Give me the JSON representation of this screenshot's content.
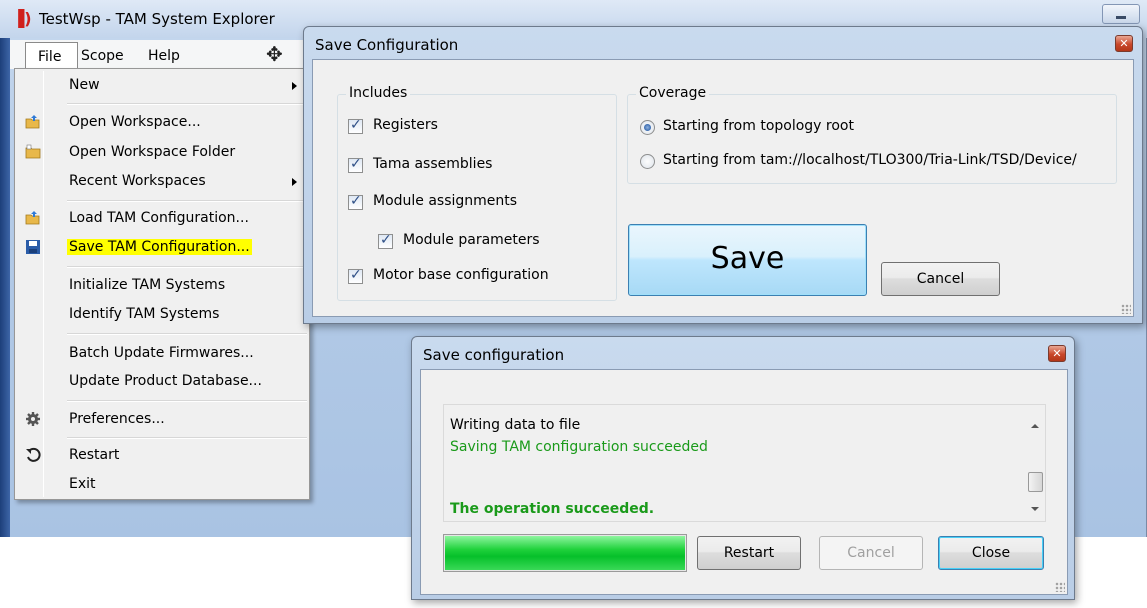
{
  "app": {
    "title": "TestWsp - TAM System Explorer"
  },
  "menubar": {
    "items": [
      "File",
      "Scope",
      "Help"
    ]
  },
  "file_menu": {
    "items": [
      {
        "label": "New",
        "icon": "none",
        "has_submenu": true
      },
      {
        "label": "Open Workspace...",
        "icon": "open-folder-icon",
        "has_submenu": false
      },
      {
        "label": "Open Workspace Folder",
        "icon": "folder-icon",
        "has_submenu": false
      },
      {
        "label": "Recent Workspaces",
        "icon": "none",
        "has_submenu": true
      },
      {
        "label": "Load TAM Configuration...",
        "icon": "open-folder-icon",
        "has_submenu": false
      },
      {
        "label": "Save TAM Configuration...",
        "icon": "floppy-disk-icon",
        "has_submenu": false,
        "highlighted": true
      },
      {
        "label": "Initialize TAM Systems",
        "icon": "none",
        "has_submenu": false
      },
      {
        "label": "Identify TAM Systems",
        "icon": "none",
        "has_submenu": false
      },
      {
        "label": "Batch Update Firmwares...",
        "icon": "none",
        "has_submenu": false
      },
      {
        "label": "Update Product Database...",
        "icon": "none",
        "has_submenu": false
      },
      {
        "label": "Preferences...",
        "icon": "gear-icon",
        "has_submenu": false
      },
      {
        "label": "Restart",
        "icon": "restart-icon",
        "has_submenu": false
      },
      {
        "label": "Exit",
        "icon": "none",
        "has_submenu": false
      }
    ],
    "highlight_color": "#ffff00"
  },
  "save_config_dialog": {
    "title": "Save Configuration",
    "includes": {
      "legend": "Includes",
      "options": [
        {
          "label": "Registers",
          "checked": true
        },
        {
          "label": "Tama assemblies",
          "checked": true
        },
        {
          "label": "Module assignments",
          "checked": true
        },
        {
          "label": "Module parameters",
          "checked": true,
          "indented": true
        },
        {
          "label": "Motor base configuration",
          "checked": true
        }
      ]
    },
    "coverage": {
      "legend": "Coverage",
      "options": [
        {
          "label": "Starting from topology root",
          "selected": true
        },
        {
          "label": "Starting from tam://localhost/TLO300/Tria-Link/TSD/Device/",
          "selected": false
        }
      ]
    },
    "save_label": "Save",
    "cancel_label": "Cancel"
  },
  "progress_dialog": {
    "title": "Save configuration",
    "log_lines": [
      {
        "text": "Writing data to file",
        "color": "#000000"
      },
      {
        "text": "Saving TAM configuration succeeded",
        "color": "#1a9a1a"
      },
      {
        "text": "The operation succeeded.",
        "color": "#1a9a1a",
        "bold": true
      }
    ],
    "progress": 1.0,
    "progress_color": "#06c02a",
    "restart_label": "Restart",
    "cancel_label": "Cancel",
    "close_label": "Close"
  }
}
